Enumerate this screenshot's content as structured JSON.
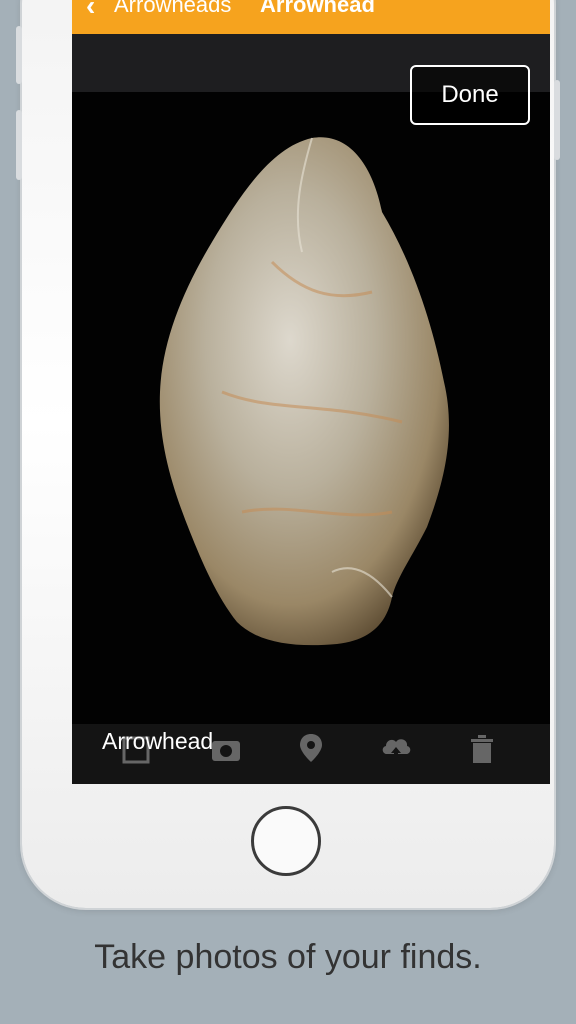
{
  "navbar": {
    "back_label": "Arrowheads",
    "title": "Arrowhead",
    "color": "#f6a31e"
  },
  "photo_view": {
    "done_label": "Done",
    "caption": "Arrowhead"
  },
  "toolbar": {
    "icons": [
      "edit-icon",
      "camera-icon",
      "location-pin-icon",
      "cloud-upload-icon",
      "trash-icon"
    ]
  },
  "tagline": "Take photos of your finds."
}
